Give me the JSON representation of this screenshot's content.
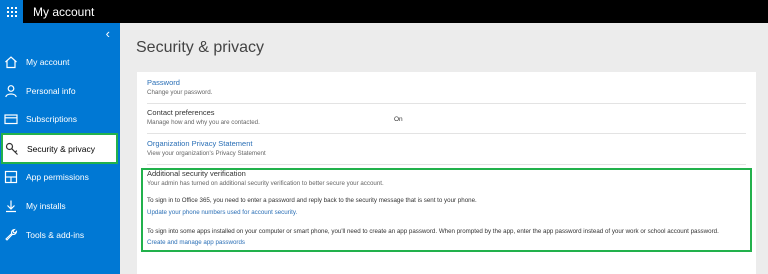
{
  "header": {
    "title": "My account"
  },
  "sidebar": {
    "collapse_glyph": "‹",
    "items": [
      {
        "label": "My account",
        "icon": "home-icon"
      },
      {
        "label": "Personal info",
        "icon": "person-icon"
      },
      {
        "label": "Subscriptions",
        "icon": "card-icon"
      },
      {
        "label": "Security & privacy",
        "icon": "key-icon",
        "selected": true
      },
      {
        "label": "App permissions",
        "icon": "grid-icon"
      },
      {
        "label": "My installs",
        "icon": "download-icon"
      },
      {
        "label": "Tools & add-ins",
        "icon": "wrench-icon"
      }
    ]
  },
  "main": {
    "title": "Security & privacy",
    "sections": {
      "password": {
        "title": "Password",
        "desc": "Change your password."
      },
      "contact": {
        "title": "Contact preferences",
        "desc": "Manage how and why you are contacted.",
        "value": "On"
      },
      "org_privacy": {
        "title": "Organization Privacy Statement",
        "desc": "View your organization's Privacy Statement"
      },
      "additional": {
        "title": "Additional security verification",
        "desc": "Your admin has turned on additional security verification to better secure your account.",
        "text1": "To sign in to Office 365, you need to enter a password and reply back to the security message that is sent to your phone.",
        "link1": "Update your phone numbers used for account security.",
        "text2": "To sign into some apps installed on your computer or smart phone, you'll need to create an app password. When prompted by the app, enter the app password instead of your work or school account password.",
        "link2": "Create and manage app passwords"
      }
    }
  },
  "colors": {
    "brand": "#0078d4",
    "highlight": "#22b14c",
    "link": "#2a6fb6"
  }
}
